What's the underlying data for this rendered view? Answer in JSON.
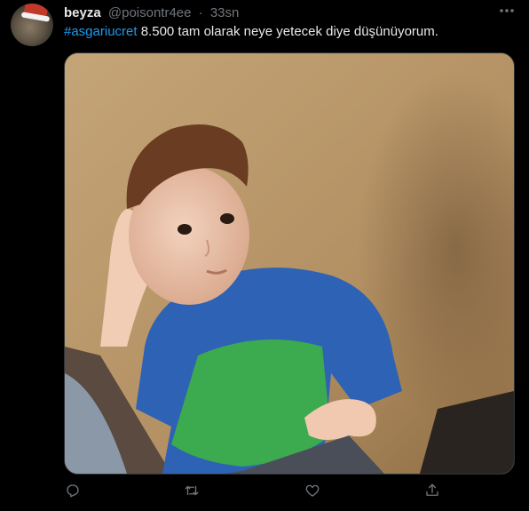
{
  "tweet": {
    "author": {
      "name": "beyza",
      "handle": "@poisontr4ee",
      "separator": "·",
      "time": "33sn"
    },
    "more_icon": "more-horizontal-icon",
    "text": {
      "hashtag": "#asgariucret",
      "body": " 8.500 tam olarak neye yetecek diye düşünüyorum."
    },
    "media": {
      "type": "photo"
    },
    "actions": [
      {
        "name": "reply",
        "icon": "reply-icon"
      },
      {
        "name": "retweet",
        "icon": "retweet-icon"
      },
      {
        "name": "like",
        "icon": "heart-icon"
      },
      {
        "name": "share",
        "icon": "share-icon"
      }
    ]
  },
  "colors": {
    "background": "#000000",
    "text": "#e7e9ea",
    "secondary": "#71767b",
    "link": "#1d9bf0",
    "border": "#2f3336"
  }
}
